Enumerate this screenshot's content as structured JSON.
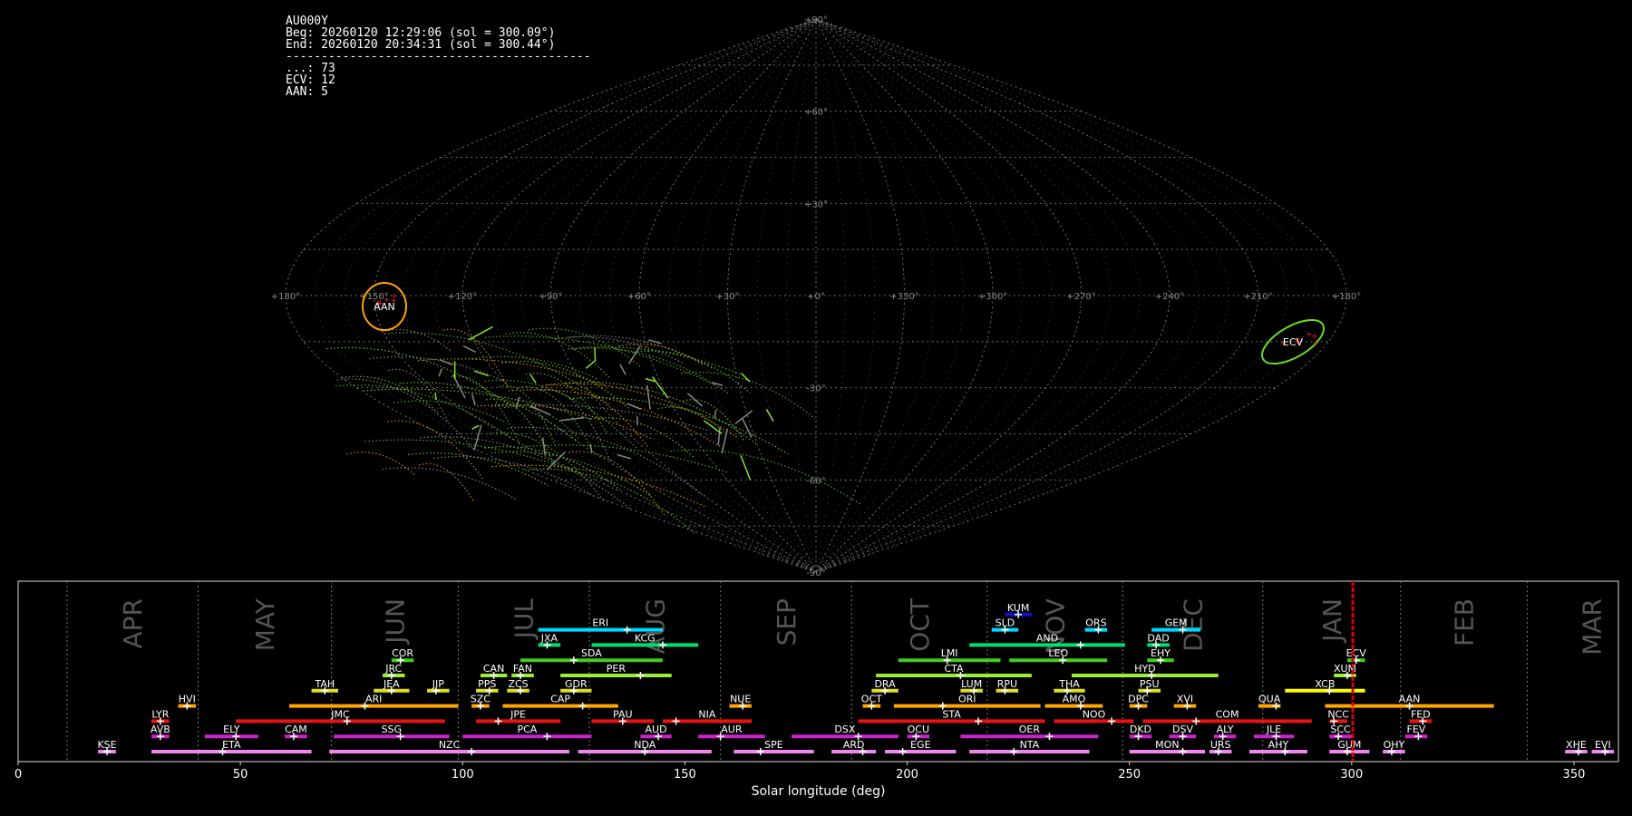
{
  "info": {
    "station": "AU000Y",
    "begin": "Beg: 20260120 12:29:06 (sol = 300.09°)",
    "end": "End: 20260120 20:34:31 (sol = 300.44°)",
    "separator": "-------------------------------------------",
    "counts": [
      {
        "code": "...",
        "count": 73
      },
      {
        "code": "ECV",
        "count": 12
      },
      {
        "code": "AAN",
        "count": 5
      }
    ]
  },
  "sky_map": {
    "projection": "sinusoidal",
    "lat_labels": [
      "+90°",
      "+60°",
      "+30°",
      "0°",
      "-30°",
      "-60°",
      "-90°"
    ],
    "lon_labels": [
      "+180°",
      "+150°",
      "+120°",
      "+90°",
      "+60°",
      "+30°",
      "+0°",
      "+330°",
      "+300°",
      "+270°",
      "+240°",
      "+210°",
      "+180°"
    ],
    "highlight_circles": [
      {
        "code": "AAN",
        "lon": 147,
        "lat": -4,
        "color": "#ffa500"
      },
      {
        "code": "ECV",
        "lon": 191,
        "lat": -19,
        "color": "#66dd22"
      }
    ]
  },
  "chart_data": {
    "type": "timeline",
    "xlabel": "Solar longitude (deg)",
    "xlim": [
      0,
      360
    ],
    "xticks": [
      0,
      50,
      100,
      150,
      200,
      250,
      300,
      350
    ],
    "current_sol": 300.25,
    "months": [
      {
        "name": "APR",
        "start": 11
      },
      {
        "name": "MAY",
        "start": 40.5
      },
      {
        "name": "JUN",
        "start": 70.5
      },
      {
        "name": "JUL",
        "start": 99
      },
      {
        "name": "AUG",
        "start": 128.5
      },
      {
        "name": "SEP",
        "start": 158
      },
      {
        "name": "OCT",
        "start": 187.5
      },
      {
        "name": "NOV",
        "start": 218
      },
      {
        "name": "DEC",
        "start": 248.5
      },
      {
        "name": "JAN",
        "start": 280
      },
      {
        "name": "FEB",
        "start": 311
      },
      {
        "name": "MAR",
        "start": 339.5
      }
    ],
    "showers": [
      {
        "code": "KUM",
        "row": 10,
        "start": 222,
        "end": 228,
        "peak": 225,
        "color": "#1010cc"
      },
      {
        "code": "ERI",
        "row": 9,
        "start": 117,
        "end": 145,
        "peak": 137,
        "color": "#00d8ff"
      },
      {
        "code": "SLD",
        "row": 9,
        "start": 219,
        "end": 225,
        "peak": 222,
        "color": "#00d8ff"
      },
      {
        "code": "ORS",
        "row": 9,
        "start": 240,
        "end": 245,
        "peak": 243,
        "color": "#00d8ff"
      },
      {
        "code": "GEM",
        "row": 9,
        "start": 255,
        "end": 266,
        "peak": 262,
        "color": "#00d8ff"
      },
      {
        "code": "JXA",
        "row": 8,
        "start": 117,
        "end": 122,
        "peak": 119,
        "color": "#00e070"
      },
      {
        "code": "KCG",
        "row": 8,
        "start": 129,
        "end": 153,
        "peak": 145,
        "color": "#00e070"
      },
      {
        "code": "AND",
        "row": 8,
        "start": 214,
        "end": 249,
        "peak": 239,
        "color": "#00e070"
      },
      {
        "code": "DAD",
        "row": 8,
        "start": 254,
        "end": 259,
        "peak": 256,
        "color": "#00e070"
      },
      {
        "code": "COR",
        "row": 7,
        "start": 84,
        "end": 89,
        "peak": 86,
        "color": "#44cc22"
      },
      {
        "code": "SDA",
        "row": 7,
        "start": 113,
        "end": 145,
        "peak": 125,
        "color": "#44cc22"
      },
      {
        "code": "LMI",
        "row": 7,
        "start": 198,
        "end": 221,
        "peak": 209,
        "color": "#44cc22"
      },
      {
        "code": "LEO",
        "row": 7,
        "start": 223,
        "end": 245,
        "peak": 235,
        "color": "#44cc22"
      },
      {
        "code": "EHY",
        "row": 7,
        "start": 254,
        "end": 260,
        "peak": 257,
        "color": "#44cc22"
      },
      {
        "code": "ECV",
        "row": 7,
        "start": 299,
        "end": 303,
        "peak": 301,
        "color": "#44cc22"
      },
      {
        "code": "JRC",
        "row": 6,
        "start": 82,
        "end": 87,
        "peak": 84,
        "color": "#99ee33"
      },
      {
        "code": "CAN",
        "row": 6,
        "start": 104,
        "end": 110,
        "peak": 107,
        "color": "#99ee33"
      },
      {
        "code": "FAN",
        "row": 6,
        "start": 111,
        "end": 116,
        "peak": 113,
        "color": "#99ee33"
      },
      {
        "code": "PER",
        "row": 6,
        "start": 122,
        "end": 147,
        "peak": 140,
        "color": "#99ee33"
      },
      {
        "code": "CTA",
        "row": 6,
        "start": 193,
        "end": 228,
        "peak": 212,
        "color": "#99ee33"
      },
      {
        "code": "HYD",
        "row": 6,
        "start": 237,
        "end": 270,
        "peak": 255,
        "color": "#99ee33"
      },
      {
        "code": "XUM",
        "row": 6,
        "start": 296,
        "end": 301,
        "peak": 299,
        "color": "#99ee33"
      },
      {
        "code": "TAH",
        "row": 5,
        "start": 66,
        "end": 72,
        "peak": 69,
        "color": "#dddd22"
      },
      {
        "code": "JEA",
        "row": 5,
        "start": 80,
        "end": 88,
        "peak": 84,
        "color": "#dddd22"
      },
      {
        "code": "JIP",
        "row": 5,
        "start": 92,
        "end": 97,
        "peak": 94,
        "color": "#dddd22"
      },
      {
        "code": "PPS",
        "row": 5,
        "start": 103,
        "end": 108,
        "peak": 106,
        "color": "#dddd22"
      },
      {
        "code": "ZCS",
        "row": 5,
        "start": 110,
        "end": 115,
        "peak": 113,
        "color": "#dddd22"
      },
      {
        "code": "GDR",
        "row": 5,
        "start": 122,
        "end": 129,
        "peak": 125,
        "color": "#dddd22"
      },
      {
        "code": "DRA",
        "row": 5,
        "start": 192,
        "end": 198,
        "peak": 195,
        "color": "#dddd22"
      },
      {
        "code": "LUM",
        "row": 5,
        "start": 212,
        "end": 217,
        "peak": 215,
        "color": "#dddd22"
      },
      {
        "code": "RPU",
        "row": 5,
        "start": 220,
        "end": 225,
        "peak": 222,
        "color": "#dddd22"
      },
      {
        "code": "THA",
        "row": 5,
        "start": 233,
        "end": 240,
        "peak": 236,
        "color": "#dddd22"
      },
      {
        "code": "PSU",
        "row": 5,
        "start": 252,
        "end": 257,
        "peak": 254,
        "color": "#dddd22"
      },
      {
        "code": "XCB",
        "row": 5,
        "start": 285,
        "end": 303,
        "peak": 295,
        "color": "#ffff00"
      },
      {
        "code": "HVI",
        "row": 4,
        "start": 36,
        "end": 40,
        "peak": 38,
        "color": "#ffa500"
      },
      {
        "code": "ARI",
        "row": 4,
        "start": 61,
        "end": 99,
        "peak": 78,
        "color": "#ffa500"
      },
      {
        "code": "SZC",
        "row": 4,
        "start": 102,
        "end": 106,
        "peak": 104,
        "color": "#ffa500"
      },
      {
        "code": "CAP",
        "row": 4,
        "start": 109,
        "end": 135,
        "peak": 127,
        "color": "#ffa500"
      },
      {
        "code": "NUE",
        "row": 4,
        "start": 160,
        "end": 165,
        "peak": 163,
        "color": "#ffa500"
      },
      {
        "code": "OCT",
        "row": 4,
        "start": 190,
        "end": 194,
        "peak": 192,
        "color": "#ffa500"
      },
      {
        "code": "ORI",
        "row": 4,
        "start": 197,
        "end": 230,
        "peak": 208,
        "color": "#ffa500"
      },
      {
        "code": "AMO",
        "row": 4,
        "start": 231,
        "end": 244,
        "peak": 239,
        "color": "#ffa500"
      },
      {
        "code": "DPC",
        "row": 4,
        "start": 250,
        "end": 254,
        "peak": 252,
        "color": "#ffa500"
      },
      {
        "code": "XVI",
        "row": 4,
        "start": 260,
        "end": 265,
        "peak": 263,
        "color": "#ffa500"
      },
      {
        "code": "QUA",
        "row": 4,
        "start": 279,
        "end": 284,
        "peak": 283,
        "color": "#ffa500"
      },
      {
        "code": "AAN",
        "row": 4,
        "start": 294,
        "end": 332,
        "peak": 313,
        "color": "#ffa500"
      },
      {
        "code": "LYR",
        "row": 3,
        "start": 30,
        "end": 34,
        "peak": 32,
        "color": "#ee1111"
      },
      {
        "code": "JMC",
        "row": 3,
        "start": 49,
        "end": 96,
        "peak": 74,
        "color": "#ee1111"
      },
      {
        "code": "JPE",
        "row": 3,
        "start": 103,
        "end": 122,
        "peak": 108,
        "color": "#ee1111"
      },
      {
        "code": "PAU",
        "row": 3,
        "start": 129,
        "end": 143,
        "peak": 136,
        "color": "#ee1111"
      },
      {
        "code": "NIA",
        "row": 3,
        "start": 145,
        "end": 165,
        "peak": 148,
        "color": "#ee1111"
      },
      {
        "code": "STA",
        "row": 3,
        "start": 189,
        "end": 231,
        "peak": 216,
        "color": "#ee1111"
      },
      {
        "code": "NOO",
        "row": 3,
        "start": 233,
        "end": 251,
        "peak": 246,
        "color": "#ee1111"
      },
      {
        "code": "COM",
        "row": 3,
        "start": 253,
        "end": 291,
        "peak": 265,
        "color": "#ee1111"
      },
      {
        "code": "NCC",
        "row": 3,
        "start": 295,
        "end": 299,
        "peak": 296,
        "color": "#ee1111"
      },
      {
        "code": "FED",
        "row": 3,
        "start": 313,
        "end": 318,
        "peak": 316,
        "color": "#ee1111"
      },
      {
        "code": "AVB",
        "row": 2,
        "start": 30,
        "end": 34,
        "peak": 32,
        "color": "#cc22cc"
      },
      {
        "code": "ELY",
        "row": 2,
        "start": 42,
        "end": 54,
        "peak": 49,
        "color": "#cc22cc"
      },
      {
        "code": "CAM",
        "row": 2,
        "start": 60,
        "end": 65,
        "peak": 62,
        "color": "#cc22cc"
      },
      {
        "code": "SSG",
        "row": 2,
        "start": 71,
        "end": 97,
        "peak": 86,
        "color": "#cc22cc"
      },
      {
        "code": "PCA",
        "row": 2,
        "start": 100,
        "end": 129,
        "peak": 119,
        "color": "#cc22cc"
      },
      {
        "code": "AUD",
        "row": 2,
        "start": 140,
        "end": 147,
        "peak": 144,
        "color": "#cc22cc"
      },
      {
        "code": "AUR",
        "row": 2,
        "start": 153,
        "end": 168,
        "peak": 158,
        "color": "#cc22cc"
      },
      {
        "code": "DSX",
        "row": 2,
        "start": 174,
        "end": 198,
        "peak": 189,
        "color": "#cc22cc"
      },
      {
        "code": "OCU",
        "row": 2,
        "start": 200,
        "end": 205,
        "peak": 202,
        "color": "#cc22cc"
      },
      {
        "code": "OER",
        "row": 2,
        "start": 212,
        "end": 243,
        "peak": 232,
        "color": "#cc22cc"
      },
      {
        "code": "DKD",
        "row": 2,
        "start": 250,
        "end": 255,
        "peak": 252,
        "color": "#cc22cc"
      },
      {
        "code": "DSV",
        "row": 2,
        "start": 259,
        "end": 265,
        "peak": 262,
        "color": "#cc22cc"
      },
      {
        "code": "ALY",
        "row": 2,
        "start": 269,
        "end": 274,
        "peak": 271,
        "color": "#cc22cc"
      },
      {
        "code": "JLE",
        "row": 2,
        "start": 278,
        "end": 287,
        "peak": 283,
        "color": "#cc22cc"
      },
      {
        "code": "SCC",
        "row": 2,
        "start": 295,
        "end": 300,
        "peak": 297,
        "color": "#cc22cc"
      },
      {
        "code": "FEV",
        "row": 2,
        "start": 312,
        "end": 317,
        "peak": 315,
        "color": "#cc22cc"
      },
      {
        "code": "KSE",
        "row": 1,
        "start": 18,
        "end": 22,
        "peak": 20,
        "color": "#ee88ee"
      },
      {
        "code": "ETA",
        "row": 1,
        "start": 30,
        "end": 66,
        "peak": 46,
        "color": "#ee88ee"
      },
      {
        "code": "NZC",
        "row": 1,
        "start": 70,
        "end": 124,
        "peak": 102,
        "color": "#ee88ee"
      },
      {
        "code": "NDA",
        "row": 1,
        "start": 126,
        "end": 156,
        "peak": 141,
        "color": "#ee88ee"
      },
      {
        "code": "SPE",
        "row": 1,
        "start": 161,
        "end": 179,
        "peak": 167,
        "color": "#ee88ee"
      },
      {
        "code": "ARD",
        "row": 1,
        "start": 183,
        "end": 193,
        "peak": 190,
        "color": "#ee88ee"
      },
      {
        "code": "EGE",
        "row": 1,
        "start": 195,
        "end": 211,
        "peak": 199,
        "color": "#ee88ee"
      },
      {
        "code": "NTA",
        "row": 1,
        "start": 214,
        "end": 241,
        "peak": 224,
        "color": "#ee88ee"
      },
      {
        "code": "MON",
        "row": 1,
        "start": 250,
        "end": 267,
        "peak": 262,
        "color": "#ee88ee"
      },
      {
        "code": "URS",
        "row": 1,
        "start": 268,
        "end": 273,
        "peak": 270,
        "color": "#ee88ee"
      },
      {
        "code": "AHY",
        "row": 1,
        "start": 277,
        "end": 290,
        "peak": 285,
        "color": "#ee88ee"
      },
      {
        "code": "GUM",
        "row": 1,
        "start": 295,
        "end": 304,
        "peak": 299,
        "color": "#ee88ee"
      },
      {
        "code": "OHY",
        "row": 1,
        "start": 307,
        "end": 312,
        "peak": 309,
        "color": "#ee88ee"
      },
      {
        "code": "XHE",
        "row": 1,
        "start": 348,
        "end": 353,
        "peak": 351,
        "color": "#ee88ee"
      },
      {
        "code": "EVI",
        "row": 1,
        "start": 354,
        "end": 359,
        "peak": 357,
        "color": "#ee88ee"
      }
    ]
  }
}
